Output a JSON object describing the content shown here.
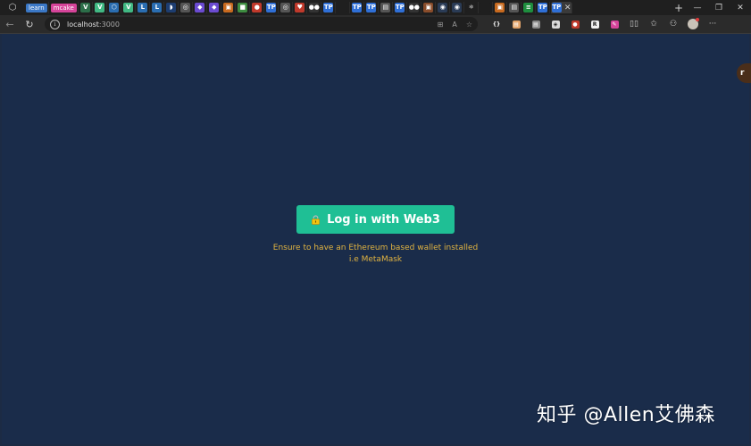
{
  "browser": {
    "tabs": [
      {
        "label": "learn",
        "color": "#3b78c6"
      },
      {
        "label": "mcake",
        "color": "#d6449a"
      },
      {
        "glyph": "V",
        "color": "#2c6e49"
      },
      {
        "glyph": "V",
        "color": "#41b883"
      },
      {
        "glyph": "⬡",
        "color": "#2a6db0"
      },
      {
        "glyph": "V",
        "color": "#41b883"
      },
      {
        "glyph": "L",
        "color": "#2a6db0"
      },
      {
        "glyph": "L",
        "color": "#2a6db0"
      },
      {
        "glyph": "◗",
        "color": "#1d3d70"
      },
      {
        "glyph": "◎",
        "color": "#555555"
      },
      {
        "glyph": "◆",
        "color": "#6b4bd1"
      },
      {
        "glyph": "◆",
        "color": "#6b4bd1"
      },
      {
        "glyph": "▣",
        "color": "#c86a1f"
      },
      {
        "glyph": "■",
        "color": "#3d8c40"
      },
      {
        "glyph": "●",
        "color": "#c0392b"
      },
      {
        "glyph": "TP",
        "color": "#2f6fd6"
      },
      {
        "glyph": "◎",
        "color": "#555555"
      },
      {
        "glyph": "♥",
        "color": "#c0392b"
      },
      {
        "glyph": "●●",
        "color": "#333333"
      },
      {
        "glyph": "TP",
        "color": "#2f6fd6"
      },
      {
        "glyph": "",
        "color": "#1f1f1f"
      },
      {
        "glyph": "TP",
        "color": "#2f6fd6"
      },
      {
        "glyph": "TP",
        "color": "#2f6fd6"
      },
      {
        "glyph": "▤",
        "color": "#555555"
      },
      {
        "glyph": "TP",
        "color": "#2f6fd6"
      },
      {
        "glyph": "●●",
        "color": "#333333"
      },
      {
        "glyph": "▣",
        "color": "#8a4d2b"
      },
      {
        "glyph": "◉",
        "color": "#2a3b55"
      },
      {
        "glyph": "◉",
        "color": "#2a3b55"
      },
      {
        "glyph": "⚛",
        "color": "#1f1f1f"
      },
      {
        "glyph": "",
        "color": "#1f1f1f"
      },
      {
        "glyph": "▣",
        "color": "#c86a1f"
      },
      {
        "glyph": "▤",
        "color": "#555555"
      },
      {
        "glyph": "≡",
        "color": "#1e8e3e"
      },
      {
        "glyph": "TP",
        "color": "#2f6fd6"
      },
      {
        "glyph": "TP",
        "color": "#2f6fd6",
        "active": true
      }
    ],
    "url_host": "localhost",
    "url_port": ":3000",
    "extensions": [
      {
        "glyph": "{}",
        "color": "#2b2b2b"
      },
      {
        "glyph": "▤",
        "color": "#e2a36a"
      },
      {
        "glyph": "▤",
        "color": "#8a8a8a"
      },
      {
        "glyph": "◈",
        "color": "#d9d9d9"
      },
      {
        "glyph": "●",
        "color": "#c0392b"
      },
      {
        "glyph": "R",
        "color": "#f2f2f2"
      },
      {
        "glyph": "✎",
        "color": "#d6449a"
      }
    ]
  },
  "page": {
    "side_widget": "r",
    "login_button_label": "Log in with Web3",
    "notice_line1": "Ensure to have an Ethereum based wallet installed",
    "notice_line2": "i.e MetaMask",
    "watermark": "知乎 @Allen艾佛森"
  },
  "colors": {
    "page_bg": "#1a2c4a",
    "button_bg": "#1fbf95",
    "notice_text": "#e0b341"
  }
}
